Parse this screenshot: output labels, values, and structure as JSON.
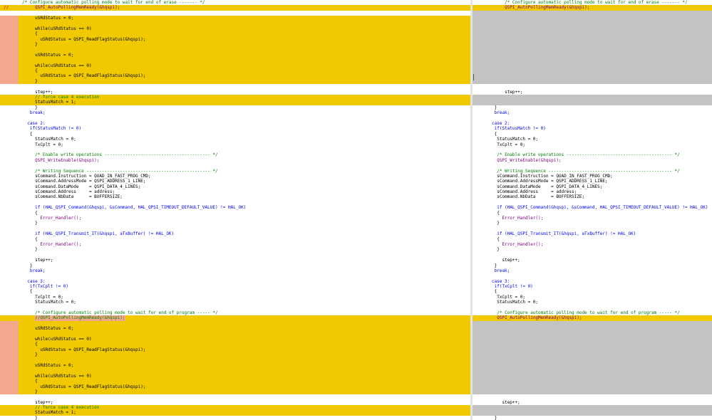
{
  "colors": {
    "changed_line": "#f0c900",
    "changed_gutter": "#f3a78c",
    "gap_line": "#c3c3c3",
    "comment": "#008000",
    "keyword": "#0000ff",
    "function": "#800080",
    "number": "#ff0000"
  },
  "left_pane": {
    "name": "left-code-pane",
    "marker": "//",
    "lines": [
      {
        "indent": 0,
        "tokens": []
      },
      {
        "type": "changed",
        "marker": true,
        "indent": 5,
        "tokens": [
          {
            "t": "",
            "c": "pl"
          }
        ]
      },
      {
        "indent": 5,
        "tokens": []
      },
      {
        "type": "changed",
        "gutter": true,
        "indent": 5,
        "tokens": [
          {
            "t": "",
            "c": "pl"
          }
        ]
      },
      {
        "type": "changed",
        "gutter": true,
        "indent": 5,
        "tokens": []
      },
      {
        "type": "changed",
        "gutter": true,
        "indent": 5,
        "tokens": [
          {
            "t": "",
            "c": "pl"
          }
        ]
      },
      {
        "type": "changed",
        "gutter": true,
        "indent": 5,
        "tokens": [
          {
            "t": "",
            "c": "pl"
          }
        ]
      },
      {
        "type": "changed",
        "gutter": true,
        "indent": 7,
        "tokens": [
          {
            "t": "",
            "c": "pl"
          }
        ]
      },
      {
        "type": "changed",
        "gutter": true,
        "indent": 5,
        "tokens": [
          {
            "t": "",
            "c": "pl"
          }
        ]
      },
      {
        "type": "changed",
        "gutter": true,
        "indent": 5,
        "tokens": []
      },
      {
        "type": "changed",
        "gutter": true,
        "indent": 5,
        "tokens": [
          {
            "t": "",
            "c": "pl"
          }
        ]
      },
      {
        "type": "changed",
        "gutter": true,
        "indent": 5,
        "tokens": []
      },
      {
        "type": "changed",
        "gutter": true,
        "indent": 5,
        "tokens": [
          {
            "t": "",
            "c": "pl"
          }
        ]
      },
      {
        "type": "changed",
        "gutter": true,
        "indent": 5,
        "tokens": [
          {
            "t": "",
            "c": "pl"
          }
        ]
      },
      {
        "type": "changed",
        "gutter": true,
        "indent": 7,
        "tokens": [
          {
            "t": "",
            "c": "pl"
          }
        ]
      },
      {
        "type": "changed",
        "gutter": true,
        "indent": 5,
        "tokens": [
          {
            "t": "",
            "c": "pl"
          }
        ]
      },
      {
        "indent": 5,
        "tokens": []
      },
      {
        "indent": 5,
        "tokens": [
          {
            "t": "",
            "c": "pl"
          }
        ]
      },
      {
        "type": "changed",
        "indent": 5,
        "tokens": [
          {
            "t": "",
            "c": "cm"
          }
        ]
      },
      {
        "type": "changed",
        "indent": 5,
        "tokens": [
          {
            "t": "",
            "c": "pl"
          },
          {
            "t": "",
            "c": "nm"
          },
          {
            "t": "",
            "c": "pl"
          }
        ]
      },
      {
        "indent": 5,
        "tokens": [
          {
            "t": "",
            "c": "pl"
          }
        ]
      },
      {
        "indent": 3,
        "tokens": [
          {
            "t": "",
            "c": "kw"
          }
        ]
      },
      {
        "indent": 0,
        "tokens": []
      },
      {
        "indent": 2,
        "tokens": [
          {
            "t": "",
            "c": "kw"
          },
          {
            "t": "",
            "c": "nm"
          },
          {
            "t": "",
            "c": "pl"
          }
        ]
      },
      {
        "indent": 3,
        "tokens": [
          {
            "t": "",
            "c": "kw"
          },
          {
            "t": "",
            "c": "pl"
          },
          {
            "t": "",
            "c": "nm"
          },
          {
            "t": "",
            "c": "pl"
          }
        ]
      },
      {
        "indent": 3,
        "tokens": [
          {
            "t": "",
            "c": "pl"
          }
        ]
      },
      {
        "indent": 5,
        "tokens": [
          {
            "t": "",
            "c": "pl"
          },
          {
            "t": "",
            "c": "nm"
          },
          {
            "t": "",
            "c": "pl"
          }
        ]
      },
      {
        "indent": 5,
        "tokens": [
          {
            "t": "",
            "c": "pl"
          },
          {
            "t": "",
            "c": "nm"
          },
          {
            "t": "",
            "c": "pl"
          }
        ]
      },
      {
        "indent": 5,
        "tokens": []
      },
      {
        "indent": 5,
        "tokens": [
          {
            "t": "",
            "c": "cm"
          }
        ]
      },
      {
        "indent": 5,
        "tokens": [
          {
            "t": "",
            "c": "fn"
          },
          {
            "t": "",
            "c": "pl"
          }
        ]
      },
      {
        "indent": 5,
        "tokens": []
      },
      {
        "indent": 5,
        "tokens": [
          {
            "t": "",
            "c": "cm"
          }
        ]
      },
      {
        "indent": 5,
        "tokens": [
          {
            "t": "",
            "c": "pl"
          }
        ]
      },
      {
        "indent": 5,
        "tokens": [
          {
            "t": "",
            "c": "pl"
          }
        ]
      },
      {
        "indent": 5,
        "tokens": [
          {
            "t": "",
            "c": "pl"
          }
        ]
      },
      {
        "indent": 5,
        "tokens": [
          {
            "t": "",
            "c": "pl"
          }
        ]
      },
      {
        "indent": 5,
        "tokens": [
          {
            "t": "",
            "c": "pl"
          }
        ]
      },
      {
        "indent": 5,
        "tokens": []
      },
      {
        "indent": 5,
        "tokens": [
          {
            "t": "",
            "c": "kw"
          },
          {
            "t": "",
            "c": "pl"
          },
          {
            "t": "",
            "c": "fn"
          },
          {
            "t": "",
            "c": "pl"
          }
        ]
      },
      {
        "indent": 5,
        "tokens": [
          {
            "t": "",
            "c": "pl"
          }
        ]
      },
      {
        "indent": 7,
        "tokens": [
          {
            "t": "",
            "c": "fn"
          },
          {
            "t": "",
            "c": "pl"
          }
        ]
      },
      {
        "indent": 5,
        "tokens": [
          {
            "t": "",
            "c": "pl"
          }
        ]
      },
      {
        "indent": 5,
        "tokens": []
      },
      {
        "indent": 5,
        "tokens": [
          {
            "t": "",
            "c": "kw"
          },
          {
            "t": "",
            "c": "pl"
          },
          {
            "t": "",
            "c": "fn"
          },
          {
            "t": "",
            "c": "pl"
          }
        ]
      },
      {
        "indent": 5,
        "tokens": [
          {
            "t": "",
            "c": "pl"
          }
        ]
      },
      {
        "indent": 7,
        "tokens": [
          {
            "t": "",
            "c": "fn"
          },
          {
            "t": "",
            "c": "pl"
          }
        ]
      },
      {
        "indent": 5,
        "tokens": [
          {
            "t": "",
            "c": "pl"
          }
        ]
      },
      {
        "indent": 5,
        "tokens": []
      },
      {
        "indent": 5,
        "tokens": [
          {
            "t": "",
            "c": "pl"
          }
        ]
      },
      {
        "indent": 3,
        "tokens": [
          {
            "t": "",
            "c": "pl"
          }
        ]
      },
      {
        "indent": 3,
        "tokens": [
          {
            "t": "",
            "c": "kw"
          }
        ]
      },
      {
        "indent": 0,
        "tokens": []
      },
      {
        "indent": 2,
        "tokens": [
          {
            "t": "",
            "c": "kw"
          },
          {
            "t": "",
            "c": "nm"
          },
          {
            "t": "",
            "c": "pl"
          }
        ]
      },
      {
        "indent": 3,
        "tokens": [
          {
            "t": "",
            "c": "kw"
          },
          {
            "t": "",
            "c": "pl"
          },
          {
            "t": "",
            "c": "nm"
          },
          {
            "t": "",
            "c": "pl"
          }
        ]
      },
      {
        "indent": 3,
        "tokens": [
          {
            "t": "",
            "c": "pl"
          }
        ]
      },
      {
        "indent": 5,
        "tokens": [
          {
            "t": "",
            "c": "pl"
          },
          {
            "t": "",
            "c": "nm"
          },
          {
            "t": "",
            "c": "pl"
          }
        ]
      },
      {
        "indent": 5,
        "tokens": [
          {
            "t": "",
            "c": "pl"
          },
          {
            "t": "",
            "c": "nm"
          },
          {
            "t": "",
            "c": "pl"
          }
        ]
      },
      {
        "indent": 5,
        "tokens": []
      },
      {
        "indent": 5,
        "tokens": [
          {
            "t": "",
            "c": "cm"
          }
        ]
      },
      {
        "type": "changed",
        "indent": 5,
        "tokens": [
          {
            "t": "",
            "c": "cm",
            "inl": true
          },
          {
            "t": "",
            "c": "pl",
            "inl": true
          }
        ]
      },
      {
        "type": "changed",
        "gutter": true,
        "indent": 5,
        "tokens": []
      },
      {
        "type": "changed",
        "gutter": true,
        "indent": 5,
        "tokens": [
          {
            "t": "",
            "c": "pl"
          }
        ]
      },
      {
        "type": "changed",
        "gutter": true,
        "indent": 5,
        "tokens": []
      },
      {
        "type": "changed",
        "gutter": true,
        "indent": 5,
        "tokens": [
          {
            "t": "",
            "c": "pl"
          }
        ]
      },
      {
        "type": "changed",
        "gutter": true,
        "indent": 5,
        "tokens": [
          {
            "t": "",
            "c": "pl"
          }
        ]
      },
      {
        "type": "changed",
        "gutter": true,
        "indent": 7,
        "tokens": [
          {
            "t": "",
            "c": "pl"
          }
        ]
      },
      {
        "type": "changed",
        "gutter": true,
        "indent": 5,
        "tokens": [
          {
            "t": "",
            "c": "pl"
          }
        ]
      },
      {
        "type": "changed",
        "gutter": true,
        "indent": 5,
        "tokens": []
      },
      {
        "type": "changed",
        "gutter": true,
        "indent": 5,
        "tokens": [
          {
            "t": "",
            "c": "pl"
          }
        ]
      },
      {
        "type": "changed",
        "gutter": true,
        "indent": 5,
        "tokens": []
      },
      {
        "type": "changed",
        "gutter": true,
        "indent": 5,
        "tokens": [
          {
            "t": "",
            "c": "pl"
          }
        ]
      },
      {
        "type": "changed",
        "gutter": true,
        "indent": 5,
        "tokens": [
          {
            "t": "",
            "c": "pl"
          }
        ]
      },
      {
        "type": "changed",
        "gutter": true,
        "indent": 7,
        "tokens": [
          {
            "t": "",
            "c": "pl"
          }
        ]
      },
      {
        "type": "changed",
        "gutter": true,
        "indent": 5,
        "tokens": [
          {
            "t": "",
            "c": "pl"
          }
        ]
      },
      {
        "indent": 5,
        "tokens": []
      },
      {
        "indent": 5,
        "tokens": [
          {
            "t": "",
            "c": "pl"
          }
        ]
      },
      {
        "type": "changed",
        "indent": 5,
        "tokens": [
          {
            "t": "",
            "c": "cm"
          }
        ]
      },
      {
        "type": "changed",
        "indent": 5,
        "tokens": [
          {
            "t": "",
            "c": "pl"
          },
          {
            "t": "",
            "c": "nm"
          },
          {
            "t": "",
            "c": "pl"
          }
        ]
      },
      {
        "indent": 5,
        "tokens": [
          {
            "t": "",
            "c": "pl"
          }
        ]
      }
    ]
  },
  "left_text": [
    "/* Configure automatic polling mode to wait for end of erase ------- */",
    "QSPI_AutoPollingMemReady(&hqspi);",
    "",
    "uSRdStatus = 0;",
    "",
    "while(uSRdStatus == 0)",
    "{",
    "uSRdStatus = QSPI_ReadFlagStatus(&hqspi);",
    "}",
    "",
    "uSRdStatus = 0;",
    "",
    "while(uSRdStatus == 0)",
    "{",
    "uSRdStatus = QSPI_ReadFlagStatus(&hqspi);",
    "}",
    "",
    "step++;",
    "// force case 4 execution",
    "StatusMatch = 1;",
    "}",
    "break;",
    "",
    "case 2:",
    "if(StatusMatch != 0)",
    "{",
    "StatusMatch = 0;",
    "TxCplt = 0;",
    "",
    "/* Enable write operations ----------------------------------------- */",
    "QSPI_WriteEnable(&hqspi);",
    "",
    "/* Writing Sequence ------------------------------------------------ */",
    "sCommand.Instruction = QUAD_IN_FAST_PROG_CMD;",
    "sCommand.AddressMode = QSPI_ADDRESS_1_LINE;",
    "sCommand.DataMode    = QSPI_DATA_4_LINES;",
    "sCommand.Address     = address;",
    "sCommand.NbData      = BUFFERSIZE;",
    "",
    "if (HAL_QSPI_Command(&hqspi, &sCommand, HAL_QPSI_TIMEOUT_DEFAULT_VALUE) != HAL_OK)",
    "{",
    "Error_Handler();",
    "}",
    "",
    "if (HAL_QSPI_Transmit_IT(&hqspi, aTxBuffer) != HAL_OK)",
    "{",
    "Error_Handler();",
    "}",
    "",
    "step++;",
    "}",
    "break;",
    "",
    "case 3:",
    "if(TxCplt != 0)",
    "{",
    "TxCplt = 0;",
    "StatusMatch = 0;",
    "",
    "/* Configure automatic polling mode to wait for end of program ----- */",
    "//QSPI_AutoPollingMemReady(&hqspi);",
    "",
    "uSRdStatus = 0;",
    "",
    "while(uSRdStatus == 0)",
    "{",
    "uSRdStatus = QSPI_ReadFlagStatus(&hqspi);",
    "}",
    "",
    "uSRdStatus = 0;",
    "",
    "while(uSRdStatus == 0)",
    "{",
    "uSRdStatus = QSPI_ReadFlagStatus(&hqspi);",
    "}",
    "",
    "step++;",
    "// force case 4 execution",
    "StatusMatch = 1;",
    "}"
  ],
  "right_text": [
    "/* Configure automatic polling mode to wait for end of erase ------- */",
    "QSPI_AutoPollingMemReady(&hqspi);",
    "step++;",
    "}",
    "break;",
    "case 2:",
    "if(StatusMatch != 0)",
    "{",
    "StatusMatch = 0;",
    "TxCplt = 0;",
    "/* Enable write operations ----------------------------------------- */",
    "QSPI_WriteEnable(&hqspi);",
    "/* Writing Sequence ------------------------------------------------ */",
    "sCommand.Instruction = QUAD_IN_FAST_PROG_CMD;",
    "sCommand.AddressMode = QSPI_ADDRESS_1_LINE;",
    "sCommand.DataMode    = QSPI_DATA_4_LINES;",
    "sCommand.Address     = address;",
    "sCommand.NbData      = BUFFERSIZE;",
    "if (HAL_QSPI_Command(&hqspi, &sCommand, HAL_QPSI_TIMEOUT_DEFAULT_VALUE) != HAL_OK)",
    "{",
    "Error_Handler();",
    "}",
    "if (HAL_QSPI_Transmit_IT(&hqspi, aTxBuffer) != HAL_OK)",
    "{",
    "Error_Handler();",
    "}",
    "step++;",
    "}",
    "break;",
    "case 3:",
    "if(TxCplt != 0)",
    "{",
    "TxCplt = 0;",
    "StatusMatch = 0;",
    "/* Configure automatic polling mode to wait for end of program ----- */",
    "QSPI_AutoPollingMemReady(&hqspi);",
    "step++;",
    "}"
  ]
}
